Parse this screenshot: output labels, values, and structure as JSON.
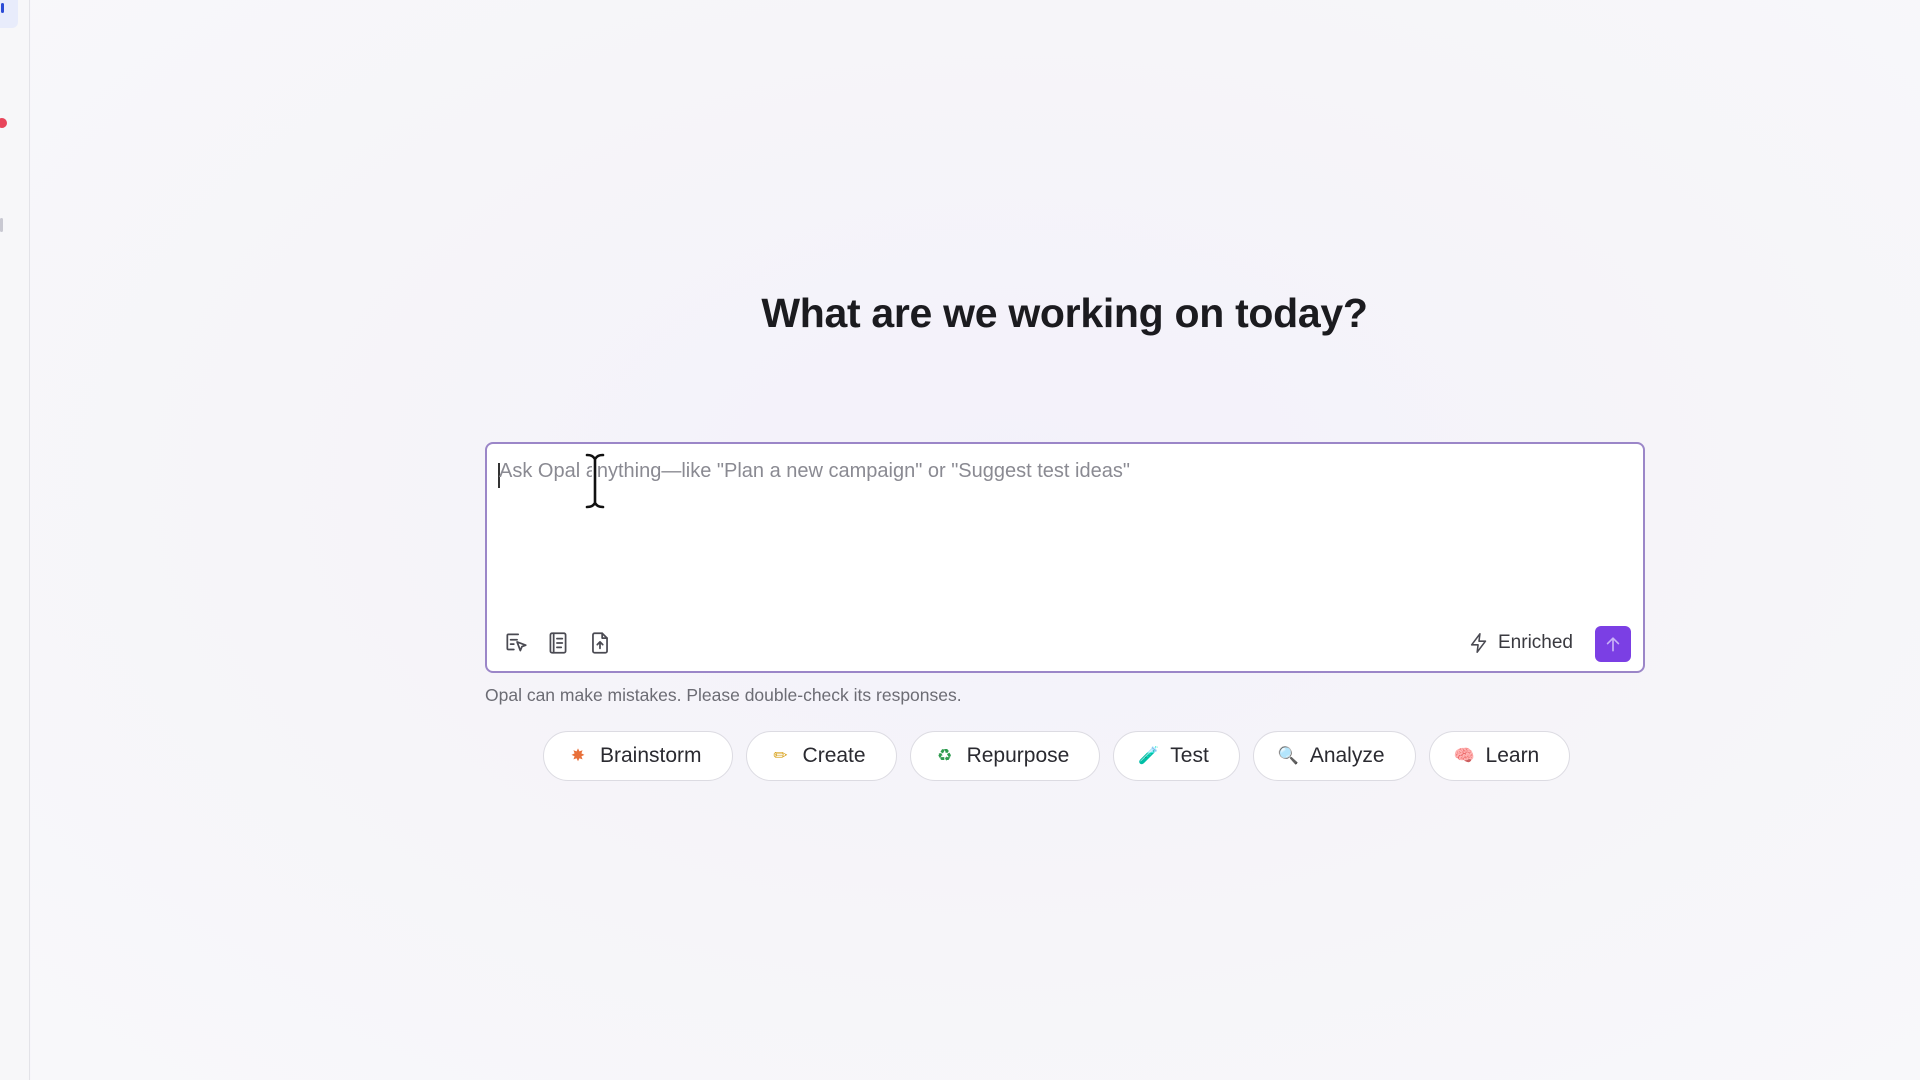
{
  "heading": "What are we working on today?",
  "composer": {
    "placeholder": "Ask Opal anything—like \"Plan a new campaign\" or \"Suggest test ideas\"",
    "value": "",
    "tools": [
      "select-element-icon",
      "notebook-icon",
      "upload-file-icon"
    ],
    "enriched_label": "Enriched",
    "send_icon": "arrow-up-icon",
    "accent_color": "#7b3fe4"
  },
  "disclaimer": "Opal can make mistakes. Please double-check its responses.",
  "chips": [
    {
      "label": "Brainstorm",
      "icon": "sparkle-icon",
      "glyph": "✸",
      "color": "#e8703a"
    },
    {
      "label": "Create",
      "icon": "pencil-icon",
      "glyph": "✏",
      "color": "#d8a21c"
    },
    {
      "label": "Repurpose",
      "icon": "recycle-icon",
      "glyph": "♻",
      "color": "#2e9b4e"
    },
    {
      "label": "Test",
      "icon": "test-tube-icon",
      "glyph": "🧪",
      "color": "#3aa35a"
    },
    {
      "label": "Analyze",
      "icon": "magnifier-icon",
      "glyph": "🔍",
      "color": "#4a6bd8"
    },
    {
      "label": "Learn",
      "icon": "brain-icon",
      "glyph": "🧠",
      "color": "#e46a8a"
    }
  ]
}
